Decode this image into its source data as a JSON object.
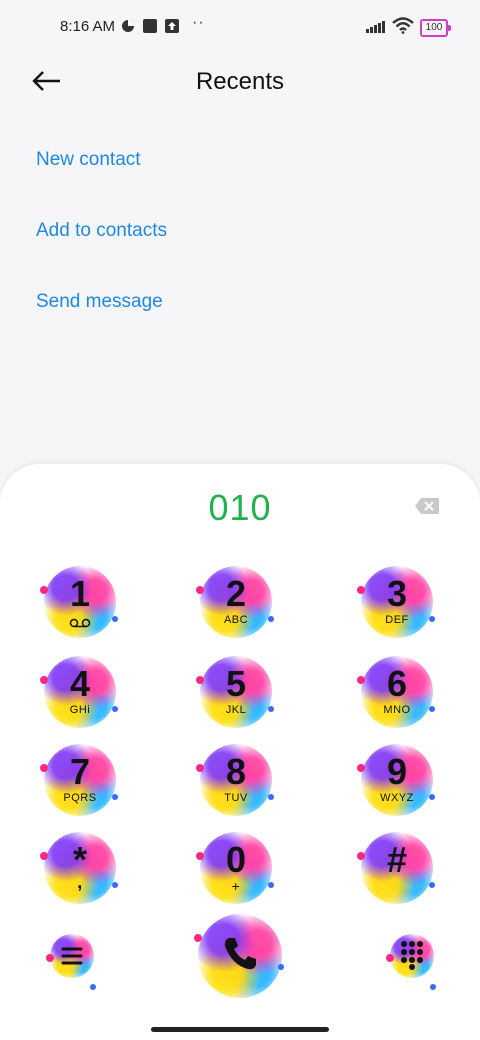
{
  "status_bar": {
    "time": "8:16 AM",
    "icons": [
      "data-saver-icon",
      "app-notification-icon",
      "upload-icon",
      "more-dots-icon",
      "signal-icon",
      "wifi-icon",
      "battery-icon"
    ],
    "dots": "··",
    "battery_level": "100",
    "battery_color": "#d13fc4"
  },
  "header": {
    "back_icon": "arrow-left-icon",
    "title": "Recents"
  },
  "actions": [
    {
      "label": "New contact"
    },
    {
      "label": "Add to contacts"
    },
    {
      "label": "Send message"
    }
  ],
  "accent_color": "#1e88e5",
  "dialer": {
    "number": "010",
    "number_color": "#22b14c",
    "backspace_icon": "backspace-icon",
    "keys": [
      {
        "digit": "1",
        "letters": "",
        "sub_icon": "voicemail-icon"
      },
      {
        "digit": "2",
        "letters": "ABC"
      },
      {
        "digit": "3",
        "letters": "DEF"
      },
      {
        "digit": "4",
        "letters": "GHi"
      },
      {
        "digit": "5",
        "letters": "JKL"
      },
      {
        "digit": "6",
        "letters": "MNO"
      },
      {
        "digit": "7",
        "letters": "PQRS"
      },
      {
        "digit": "8",
        "letters": "TUV"
      },
      {
        "digit": "9",
        "letters": "WXYZ"
      },
      {
        "digit": "*",
        "letters": ","
      },
      {
        "digit": "0",
        "letters": "+"
      },
      {
        "digit": "#",
        "letters": ""
      }
    ],
    "bottom": {
      "menu_icon": "menu-icon",
      "call_icon": "phone-icon",
      "keypad_icon": "dialpad-icon"
    }
  }
}
